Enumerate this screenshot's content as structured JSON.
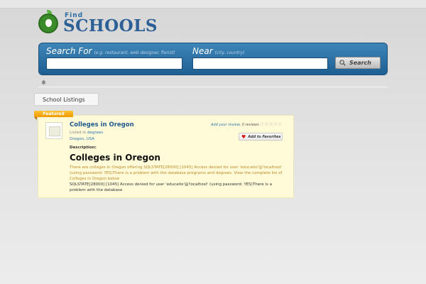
{
  "logo": {
    "find": "Find",
    "schools": "SCHOOLS"
  },
  "search": {
    "search_for_label": "Search For",
    "search_for_hint": "(e.g. restaurant, web designer, florist)",
    "search_for_value": "",
    "near_label": "Near",
    "near_hint": "(city, country)",
    "near_value": "",
    "button_label": "Search"
  },
  "tabs": {
    "school_listings": "School Listings"
  },
  "listing": {
    "badge": "Featured",
    "title": "Colleges in Oregon",
    "listed_prefix": "Listed in",
    "category": "degrees",
    "location": "Oregon, USA",
    "review_link": "Add your review,",
    "review_count": "0 reviews",
    "favorites_label": "Add to Favorites",
    "description_label": "Description:",
    "heading": "Colleges in Oregon",
    "error_intro": "There are colleges in Oregon offering SQLSTATE[28000] [1045] Access denied for user 'educatio'@'localhost' (using password: YES)There is a problem with the database programs and degrees. View the complete list of Colleges in Oregon below",
    "error_detail": "SQLSTATE[28000] [1045] Access denied for user 'educatio'@'localhost' (using password: YES)There is a problem with the database"
  },
  "icons": {
    "logo": "apple-icon",
    "search_button": "magnifier-icon",
    "home": "home-icon",
    "favorites": "heart-icon",
    "rating": "star-icon"
  },
  "colors": {
    "search_bar": "#2a6fa4",
    "badge": "#f5a800",
    "listing_bg": "#fffbd9",
    "link": "#2e76ad"
  }
}
